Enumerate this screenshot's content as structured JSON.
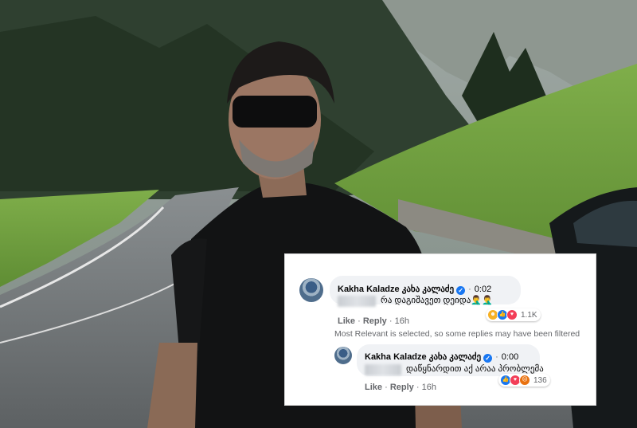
{
  "comment": {
    "author": "Kakha Kaladze კახა კალაძე",
    "time": "0:02",
    "text": "რა დაგიშავეთ დეიდა🤦‍♂️🤦‍♂️",
    "reaction_count": "1.1K",
    "like": "Like",
    "reply": "Reply",
    "age": "16h"
  },
  "filter_notice": "Most Relevant is selected, so some replies may have been filtered",
  "reply": {
    "author": "Kakha Kaladze კახა კალაძე",
    "time": "0:00",
    "text": "დაწყნარდით აქ არაა პრობლემა",
    "reaction_count": "136",
    "like": "Like",
    "reply": "Reply",
    "age": "16h"
  },
  "separators": {
    "dot": "·",
    "middot": "·"
  },
  "icons": {
    "verified": "verified-badge-icon",
    "reactions_comment": [
      "haha",
      "like",
      "love"
    ],
    "reactions_reply": [
      "like",
      "love",
      "angry"
    ]
  },
  "colors": {
    "fb_blue": "#1877f2",
    "bubble": "#f0f2f5",
    "muted": "#65676b"
  }
}
